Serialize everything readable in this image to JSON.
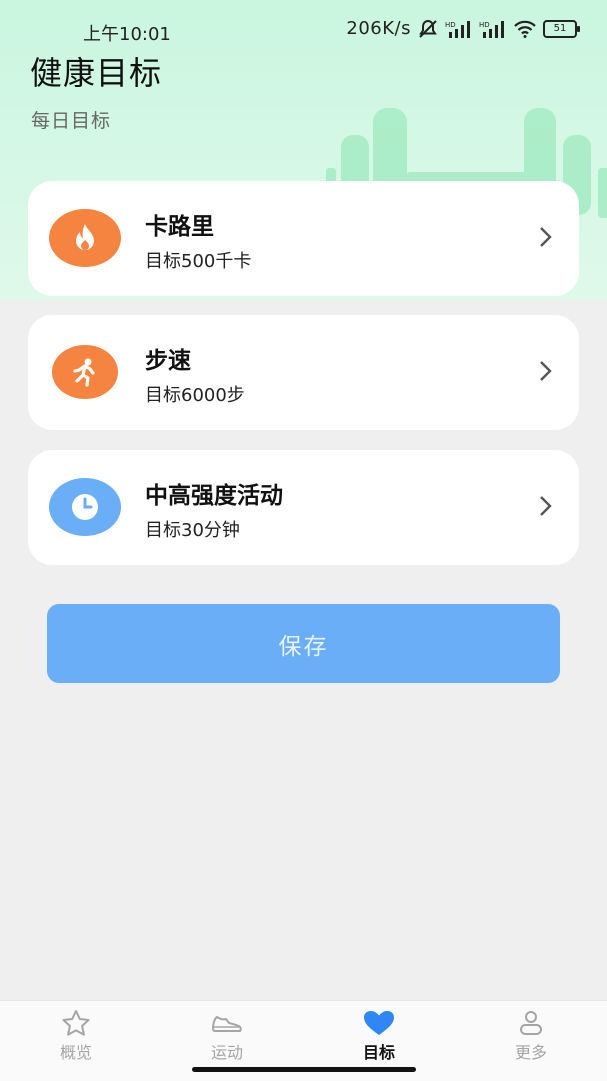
{
  "status_bar": {
    "time": "上午10:01",
    "network_speed": "206K/s",
    "battery_level": "51"
  },
  "header": {
    "title": "健康目标",
    "section_label": "每日目标"
  },
  "goals": [
    {
      "title": "卡路里",
      "subtitle": "目标500千卡",
      "icon": "flame-icon",
      "color": "#f4843f"
    },
    {
      "title": "步速",
      "subtitle": "目标6000步",
      "icon": "running-person-icon",
      "color": "#f4843f"
    },
    {
      "title": "中高强度活动",
      "subtitle": "目标30分钟",
      "icon": "clock-icon",
      "color": "#6aaef8"
    }
  ],
  "save_label": "保存",
  "tabs": [
    {
      "label": "概览",
      "icon": "star-icon"
    },
    {
      "label": "运动",
      "icon": "shoe-icon"
    },
    {
      "label": "目标",
      "icon": "heart-icon",
      "active": true
    },
    {
      "label": "更多",
      "icon": "person-icon"
    }
  ],
  "colors": {
    "header_bg": "#c9f6df",
    "accent": "#6aaef8",
    "orange": "#f4843f",
    "page_bg": "#efefef"
  }
}
